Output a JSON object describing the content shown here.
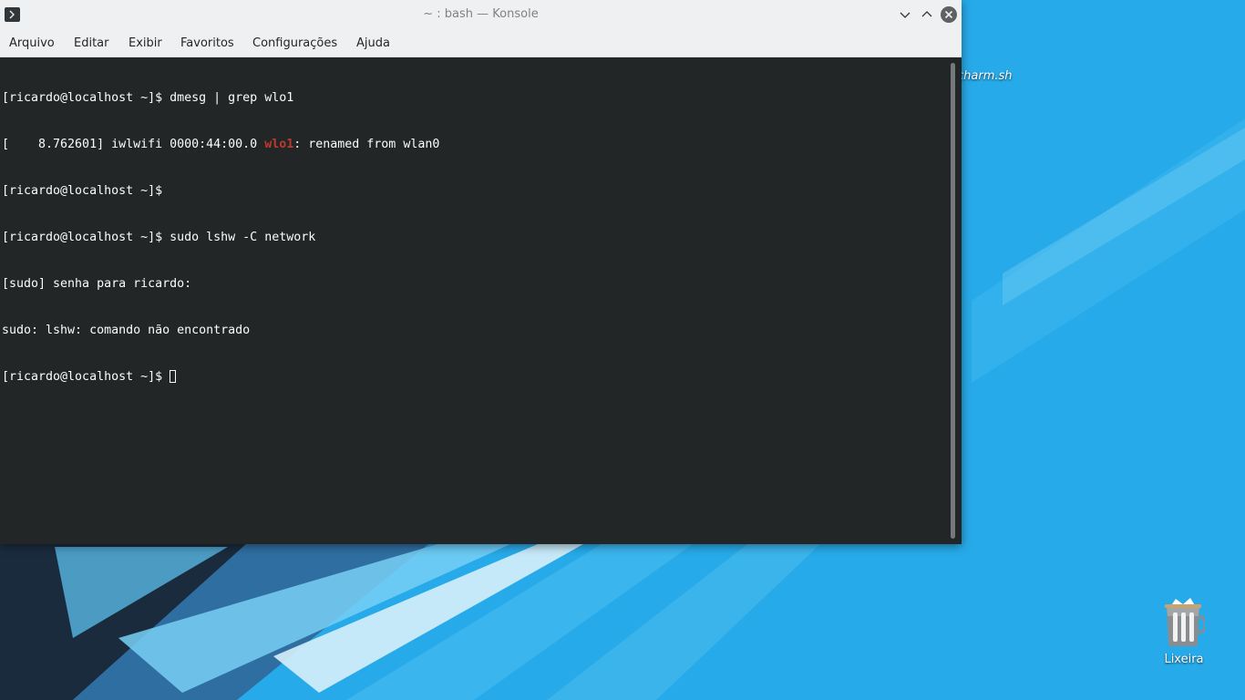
{
  "desktop": {
    "file_label": "charm.sh",
    "trash_label": "Lixeira",
    "colors": {
      "background": "#27aae9",
      "stripe_light": "#5cc2f0",
      "stripe_white": "#d8f0fb",
      "dark_area": "#1a2b3d"
    }
  },
  "window": {
    "title": "~ : bash — Konsole",
    "menu": {
      "arquivo": "Arquivo",
      "editar": "Editar",
      "exibir": "Exibir",
      "favoritos": "Favoritos",
      "configuracoes": "Configurações",
      "ajuda": "Ajuda"
    },
    "icons": {
      "app": "konsole-icon",
      "minimize": "chevron-down-icon",
      "maximize": "chevron-up-icon",
      "close": "close-icon"
    }
  },
  "terminal": {
    "line1": "[ricardo@localhost ~]$ dmesg | grep wlo1",
    "line2_pre": "[    8.762601] iwlwifi 0000:44:00.0 ",
    "line2_highlight": "wlo1",
    "line2_post": ": renamed from wlan0",
    "line3": "[ricardo@localhost ~]$ ",
    "line4": "[ricardo@localhost ~]$ sudo lshw -C network",
    "line5": "[sudo] senha para ricardo: ",
    "line6": "sudo: lshw: comando não encontrado",
    "line7": "[ricardo@localhost ~]$ ",
    "colors": {
      "background": "#232627",
      "foreground": "#fcfcfc",
      "highlight": "#c0392b"
    }
  }
}
